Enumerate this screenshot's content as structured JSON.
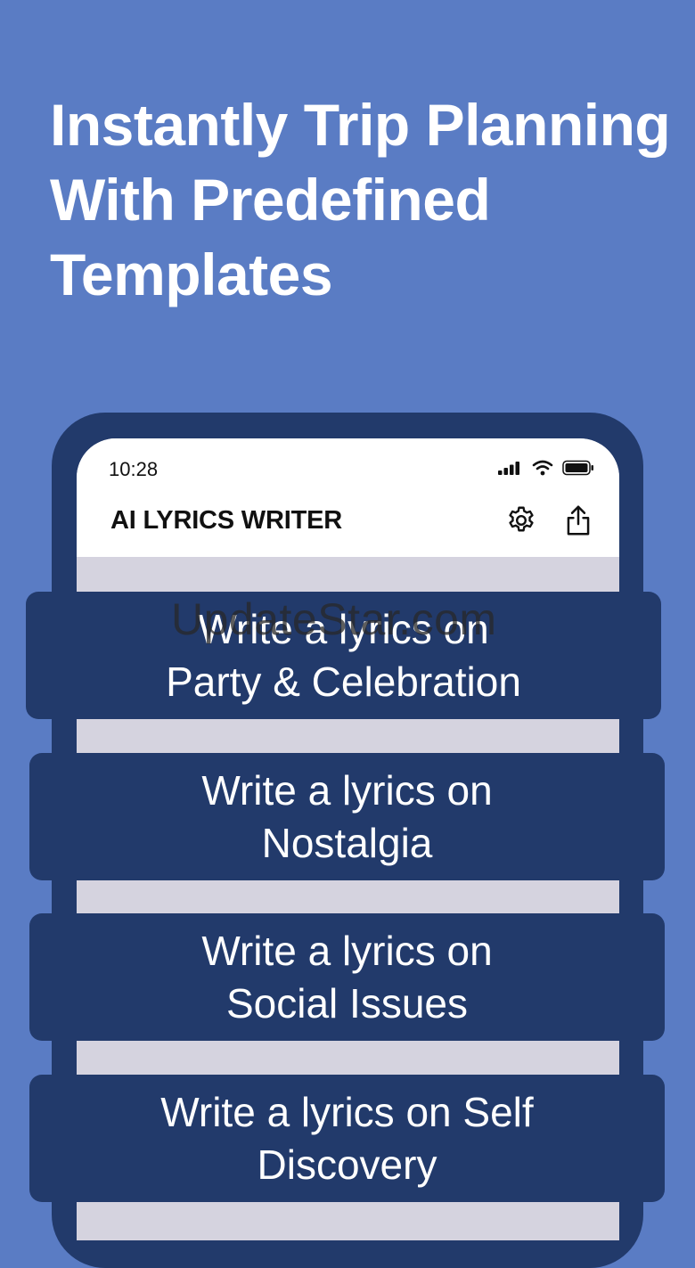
{
  "headline": {
    "line1": "Instantly Trip Planning",
    "line2": "With Predefined",
    "line3": "Templates"
  },
  "status_bar": {
    "time": "10:28",
    "icons": [
      "signal-icon",
      "wifi-icon",
      "battery-icon"
    ]
  },
  "app_bar": {
    "title": "AI LYRICS WRITER",
    "actions": [
      "gear-icon",
      "share-icon"
    ]
  },
  "templates": [
    {
      "line1": "Write a lyrics on",
      "line2": "Party & Celebration"
    },
    {
      "line1": "Write a lyrics on",
      "line2": "Nostalgia"
    },
    {
      "line1": "Write a lyrics on",
      "line2": "Social Issues"
    },
    {
      "line1": "Write a lyrics on Self",
      "line2": "Discovery"
    }
  ],
  "watermark": "UpdateStar.com",
  "colors": {
    "background": "#5a7cc4",
    "phone_frame": "#223a6b",
    "card": "#223a6b",
    "screen_bg": "#d5d3df"
  }
}
